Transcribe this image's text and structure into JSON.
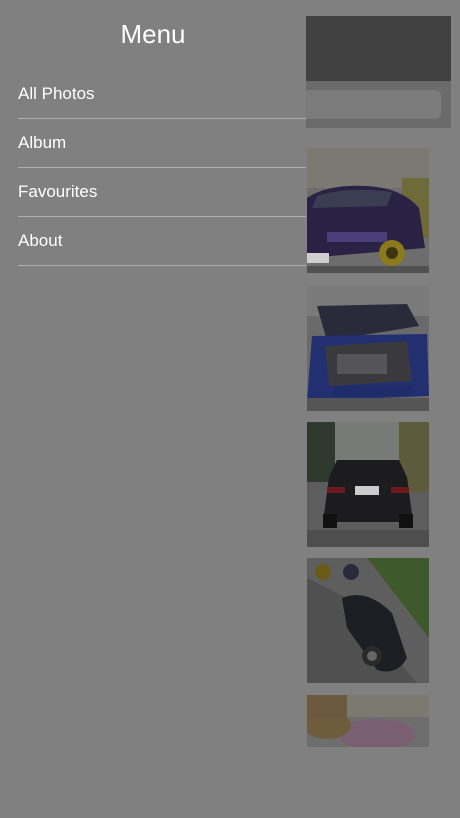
{
  "menu": {
    "title": "Menu",
    "items": [
      {
        "label": "All Photos"
      },
      {
        "label": "Album"
      },
      {
        "label": "Favourites"
      },
      {
        "label": "About"
      }
    ]
  },
  "background": {
    "photos": [
      {
        "name": "purple-bmw-coupe-photo"
      },
      {
        "name": "blue-bmw-engine-bay-photo"
      },
      {
        "name": "black-bmw-rear-photo"
      },
      {
        "name": "black-bmw-driveway-photo"
      },
      {
        "name": "pink-blossom-tree-photo"
      }
    ]
  },
  "colors": {
    "drawer_bg": "#808080",
    "navbar_dimmed": "#414141",
    "menu_text": "#ffffff",
    "divider": "#b0b0b0"
  }
}
